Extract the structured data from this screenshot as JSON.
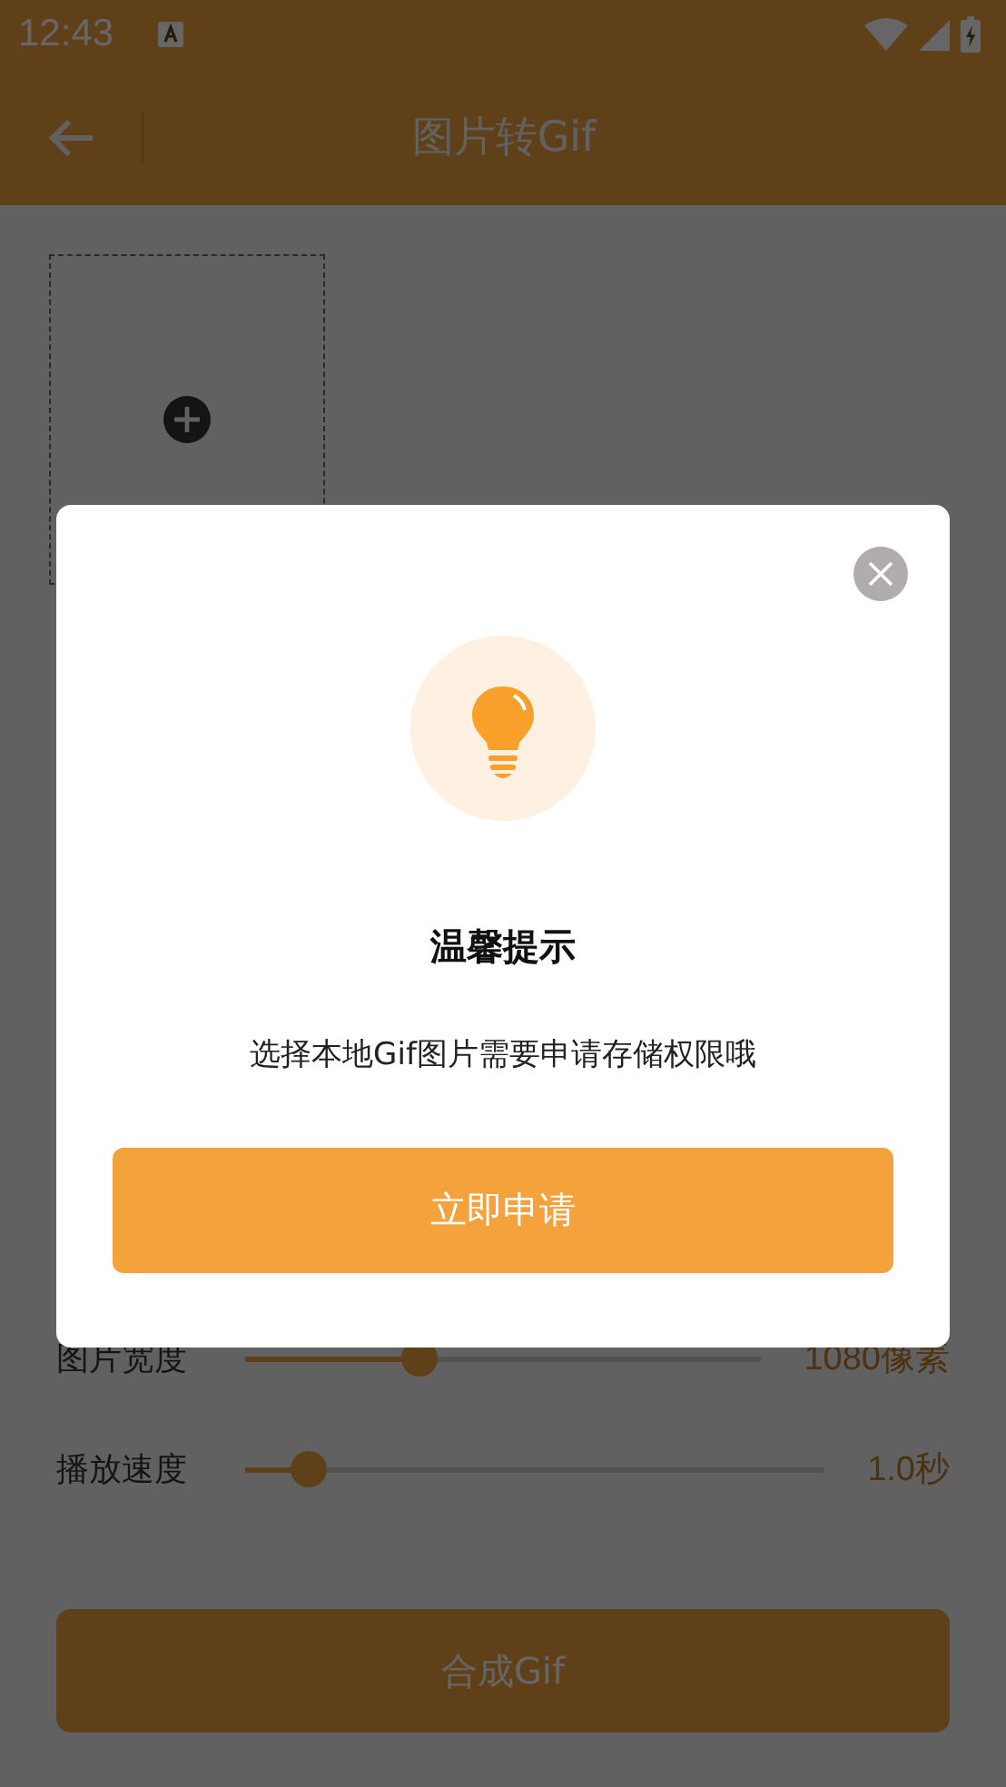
{
  "status_bar": {
    "time": "12:43"
  },
  "toolbar": {
    "title": "图片转Gif"
  },
  "settings": [
    {
      "label": "图片宽度",
      "level": 0.34,
      "reading": "1080像素"
    },
    {
      "label": "播放速度",
      "level": 0.11,
      "reading": "1.0秒"
    }
  ],
  "action_button": {
    "label": "合成Gif"
  },
  "dialog": {
    "title": "温馨提示",
    "message": "选择本地Gif图片需要申请存储权限哦",
    "button": "立即申请"
  }
}
